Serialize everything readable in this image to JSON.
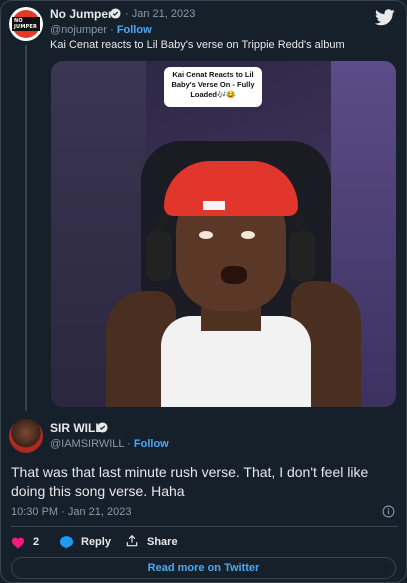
{
  "tweet1": {
    "author_name": "No Jumper",
    "date": "· Jan 21, 2023",
    "handle": "@nojumper · ",
    "follow": "Follow",
    "text": "Kai Cenat reacts to Lil Baby's verse on Trippie Redd's album",
    "avatar_badge": "NO JUMPER",
    "media_caption_line1": "Kai Cenat Reacts to Lil",
    "media_caption_line2": "Baby's Verse On - Fully",
    "media_caption_line3": "Loaded🎶😂"
  },
  "tweet2": {
    "author_name": "SIR WILL",
    "handle": "@IAMSIRWILL · ",
    "follow": "Follow",
    "text": "That was that last minute rush verse. That, I don't feel like doing this song verse. Haha",
    "timestamp": "10:30 PM · Jan 21, 2023"
  },
  "actions": {
    "like_count": "2",
    "reply_label": "Reply",
    "share_label": "Share",
    "read_more": "Read more on Twitter"
  },
  "colors": {
    "background": "#15202b",
    "accent": "#4ea8f0",
    "heart": "#f91880"
  }
}
